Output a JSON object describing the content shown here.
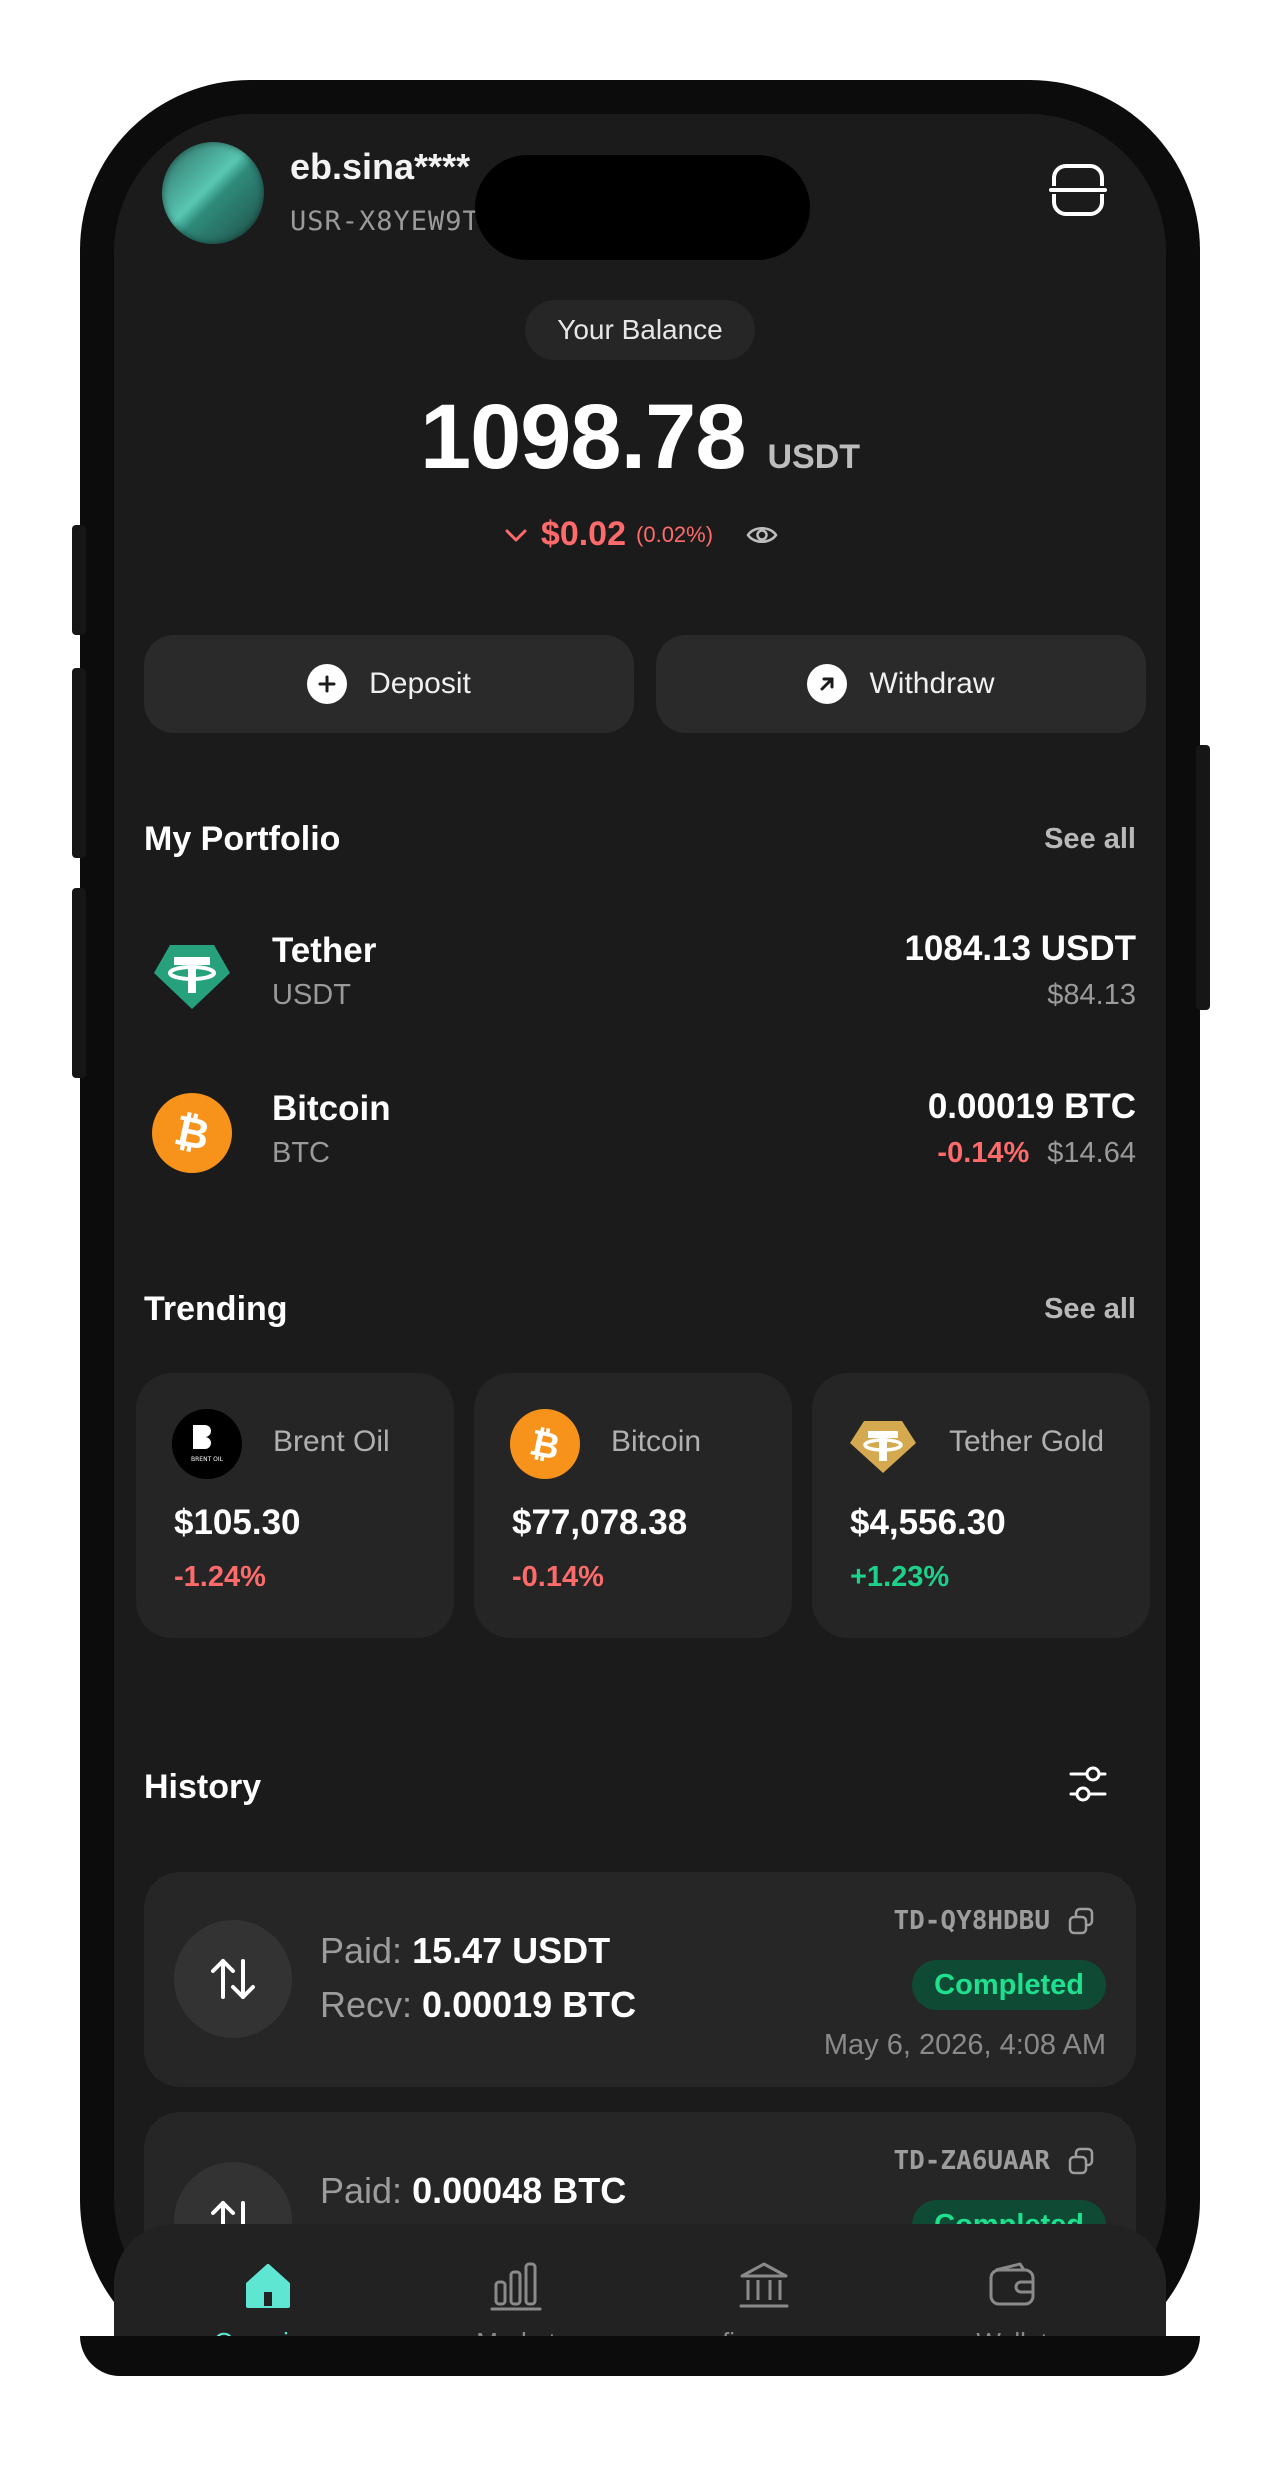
{
  "header": {
    "username": "eb.sina****",
    "user_id": "USR-X8YEW9T"
  },
  "balance": {
    "label": "Your Balance",
    "amount": "1098.78",
    "unit": "USDT",
    "change_amount": "$0.02",
    "change_pct": "(0.02%)"
  },
  "actions": {
    "deposit": "Deposit",
    "withdraw": "Withdraw"
  },
  "portfolio": {
    "title": "My Portfolio",
    "see_all": "See all",
    "items": [
      {
        "name": "Tether",
        "symbol": "USDT",
        "amount": "1084.13 USDT",
        "value": "$84.13",
        "change": ""
      },
      {
        "name": "Bitcoin",
        "symbol": "BTC",
        "amount": "0.00019 BTC",
        "change": "-0.14%",
        "value": "$14.64"
      }
    ]
  },
  "trending": {
    "title": "Trending",
    "see_all": "See all",
    "items": [
      {
        "name": "Brent Oil",
        "price": "$105.30",
        "change": "-1.24%",
        "icon_text": "BRENT OIL"
      },
      {
        "name": "Bitcoin",
        "price": "$77,078.38",
        "change": "-0.14%"
      },
      {
        "name": "Tether Gold",
        "price": "$4,556.30",
        "change": "+1.23%"
      }
    ]
  },
  "history": {
    "title": "History",
    "items": [
      {
        "paid_label": "Paid:",
        "paid": "15.47 USDT",
        "recv_label": "Recv:",
        "recv": "0.00019 BTC",
        "id": "TD-QY8HDBU",
        "status": "Completed",
        "date": "May 6, 2026, 4:08 AM"
      },
      {
        "paid_label": "Paid:",
        "paid": "0.00048 BTC",
        "id": "TD-ZA6UAAR",
        "status": "Completed"
      }
    ]
  },
  "tabs": [
    {
      "label": "Overview",
      "icon": "home-icon",
      "active": true
    },
    {
      "label": "Market",
      "icon": "bar-chart-icon",
      "active": false
    },
    {
      "label": "finance",
      "icon": "bank-icon",
      "active": false
    },
    {
      "label": "Wallet",
      "icon": "wallet-icon",
      "active": false
    }
  ],
  "colors": {
    "background": "#1b1b1b",
    "accent": "#5fe6d2",
    "negative": "#ff6b6b",
    "positive": "#1ed18a"
  }
}
